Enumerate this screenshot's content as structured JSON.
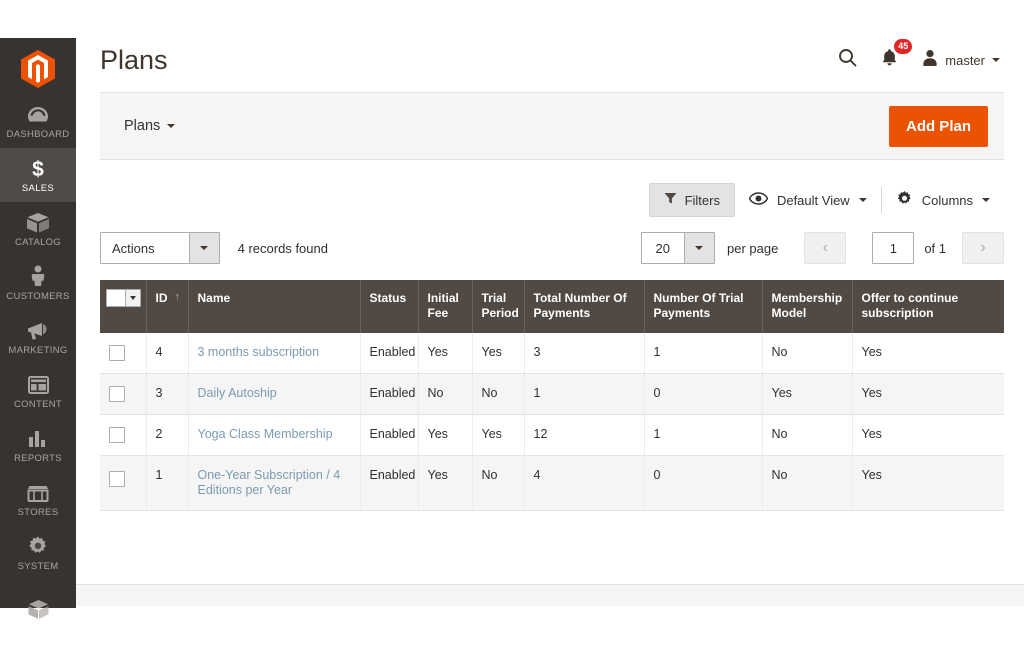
{
  "sidebar": {
    "logo_name": "magento-logo-icon",
    "items": [
      {
        "label": "DASHBOARD",
        "icon": "dashboard-icon",
        "active": false
      },
      {
        "label": "SALES",
        "icon": "sales-dollar-icon",
        "active": true
      },
      {
        "label": "CATALOG",
        "icon": "catalog-box-icon",
        "active": false
      },
      {
        "label": "CUSTOMERS",
        "icon": "customers-person-icon",
        "active": false
      },
      {
        "label": "MARKETING",
        "icon": "marketing-megaphone-icon",
        "active": false
      },
      {
        "label": "CONTENT",
        "icon": "content-layout-icon",
        "active": false
      },
      {
        "label": "REPORTS",
        "icon": "reports-bar-chart-icon",
        "active": false
      },
      {
        "label": "STORES",
        "icon": "stores-storefront-icon",
        "active": false
      },
      {
        "label": "SYSTEM",
        "icon": "system-gear-icon",
        "active": false
      },
      {
        "label": "",
        "icon": "partners-extensions-icon",
        "active": false
      }
    ]
  },
  "header": {
    "title": "Plans",
    "search_icon": "search-icon",
    "notifications_icon": "bell-icon",
    "notifications_count": "45",
    "user_icon": "user-avatar-icon",
    "user_name": "master"
  },
  "actions_bar": {
    "bookmark_label": "Plans",
    "add_button_label": "Add Plan"
  },
  "grid_tools": {
    "filters_label": "Filters",
    "view_label": "Default View",
    "columns_label": "Columns"
  },
  "controls": {
    "actions_label": "Actions",
    "records_found": "4 records found",
    "per_page_value": "20",
    "per_page_label": "per page",
    "prev_label": "‹",
    "page_value": "1",
    "of_label": "of 1",
    "next_label": "›"
  },
  "table": {
    "columns": [
      {
        "key": "check",
        "label": ""
      },
      {
        "key": "id",
        "label": "ID",
        "sort": "asc"
      },
      {
        "key": "name",
        "label": "Name"
      },
      {
        "key": "status",
        "label": "Status"
      },
      {
        "key": "initial_fee",
        "label": "Initial Fee"
      },
      {
        "key": "trial_period",
        "label": "Trial Period"
      },
      {
        "key": "total_payments",
        "label": "Total Number Of Payments"
      },
      {
        "key": "trial_payments",
        "label": "Number Of Trial Payments"
      },
      {
        "key": "membership_model",
        "label": "Membership Model"
      },
      {
        "key": "offer_continue",
        "label": "Offer to continue subscription"
      }
    ],
    "rows": [
      {
        "id": "4",
        "name": "3 months subscription",
        "status": "Enabled",
        "initial_fee": "Yes",
        "trial_period": "Yes",
        "total_payments": "3",
        "trial_payments": "1",
        "membership_model": "No",
        "offer_continue": "Yes"
      },
      {
        "id": "3",
        "name": "Daily Autoship",
        "status": "Enabled",
        "initial_fee": "No",
        "trial_period": "No",
        "total_payments": "1",
        "trial_payments": "0",
        "membership_model": "Yes",
        "offer_continue": "Yes"
      },
      {
        "id": "2",
        "name": "Yoga Class Membership",
        "status": "Enabled",
        "initial_fee": "Yes",
        "trial_period": "Yes",
        "total_payments": "12",
        "trial_payments": "1",
        "membership_model": "No",
        "offer_continue": "Yes"
      },
      {
        "id": "1",
        "name": "One-Year Subscription / 4 Editions per Year",
        "status": "Enabled",
        "initial_fee": "Yes",
        "trial_period": "No",
        "total_payments": "4",
        "trial_payments": "0",
        "membership_model": "No",
        "offer_continue": "Yes"
      }
    ]
  },
  "colors": {
    "brand_orange": "#eb5202",
    "sidebar_bg": "#373330",
    "table_header_bg": "#514943",
    "badge_red": "#e22626",
    "link_blue": "#7a9bb0"
  }
}
